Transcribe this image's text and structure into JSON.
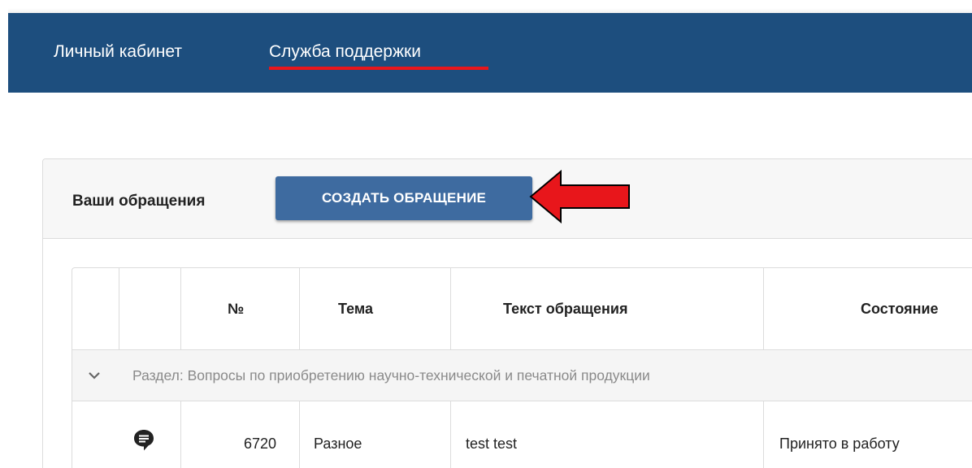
{
  "nav": {
    "personal_label": "Личный кабинет",
    "support_label": "Служба поддержки",
    "bar_color": "#1d4e7e",
    "active_underline_color": "#e8161b"
  },
  "panel": {
    "title": "Ваши обращения",
    "create_button_label": "СОЗДАТЬ ОБРАЩЕНИЕ",
    "button_color": "#3e6ba0",
    "annotation": {
      "icon": "red-arrow-left-icon",
      "color": "#e8161b"
    }
  },
  "table": {
    "headers": [
      "",
      "",
      "№",
      "Тема",
      "Текст обращения",
      "Состояние"
    ],
    "groups": [
      {
        "label": "Раздел: Вопросы по приобретению научно-технической и печатной продукции",
        "expand_icon": "chevron-down-icon",
        "rows": [
          {
            "icon": "chat-bubble-icon",
            "number": "6720",
            "topic": "Разное",
            "text": "test test",
            "status": "Принято в работу"
          }
        ]
      }
    ]
  }
}
